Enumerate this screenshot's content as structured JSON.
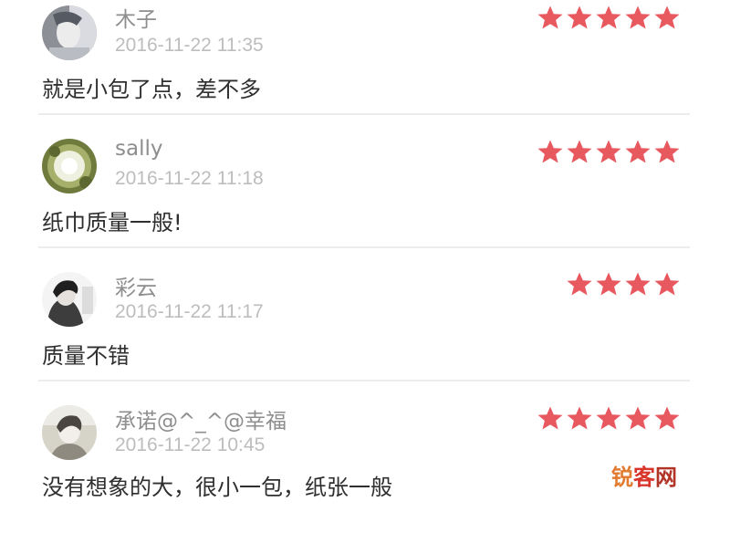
{
  "reviews": [
    {
      "username": "木子",
      "time": "2016-11-22 11:35",
      "comment": "就是小包了点，差不多",
      "rating": 5,
      "avatar_icon": "portrait-avatar-icon"
    },
    {
      "username": "sally",
      "time": "2016-11-22 11:18",
      "comment": "纸巾质量一般!",
      "rating": 5,
      "avatar_icon": "flower-avatar-icon"
    },
    {
      "username": "彩云",
      "time": "2016-11-22 11:17",
      "comment": "质量不错",
      "rating": 4,
      "avatar_icon": "portrait-avatar-icon"
    },
    {
      "username": "承诺@^_^@幸福",
      "time": "2016-11-22 10:45",
      "comment": "没有想象的大，很小一包，纸张一般",
      "rating": 5,
      "avatar_icon": "portrait-avatar-icon"
    }
  ],
  "colors": {
    "star": "#e8585f",
    "username": "#8e8e8e",
    "timestamp": "#bdbdbd",
    "comment": "#2f2f2f",
    "divider": "#ececec"
  },
  "watermark": {
    "text": "锐客网",
    "colors": [
      "#e27b2f",
      "#d9342a",
      "#b23427"
    ]
  }
}
